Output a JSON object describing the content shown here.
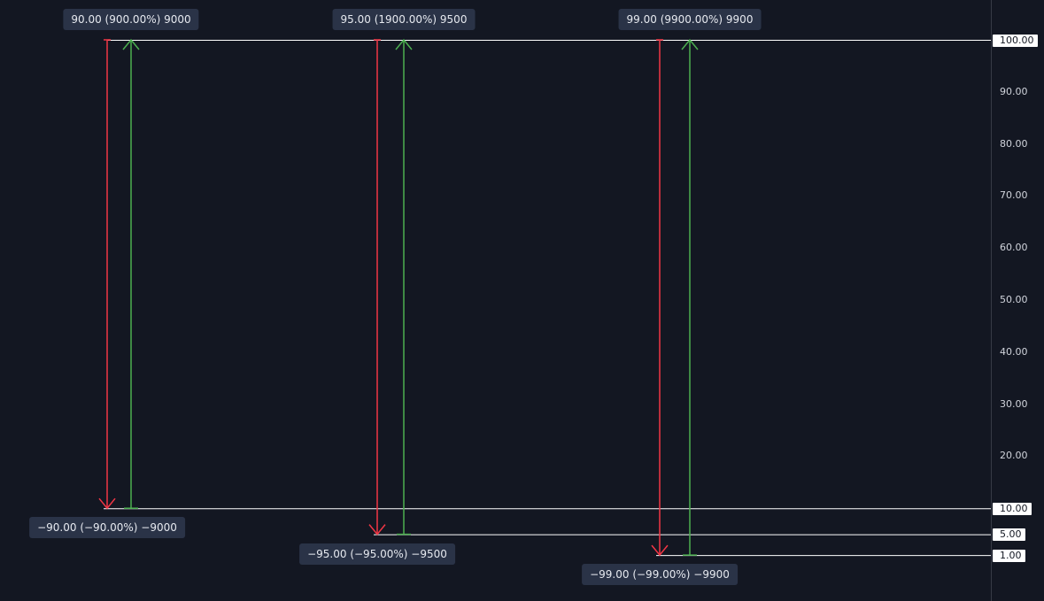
{
  "chart_data": {
    "type": "line",
    "ylim": [
      0,
      100
    ],
    "y_ticks": [
      "90.00",
      "80.00",
      "70.00",
      "60.00",
      "50.00",
      "40.00",
      "30.00",
      "20.00"
    ],
    "price_levels": [
      "100.00",
      "10.00",
      "5.00",
      "1.00"
    ],
    "measurements": [
      {
        "top_label": "90.00 (900.00%) 9000",
        "bottom_label": "−90.00 (−90.00%) −9000",
        "high": 100,
        "low": 10,
        "short_change": "−90.00",
        "long_change": "90.00"
      },
      {
        "top_label": "95.00 (1900.00%) 9500",
        "bottom_label": "−95.00 (−95.00%) −9500",
        "high": 100,
        "low": 5,
        "short_change": "−95.00",
        "long_change": "95.00"
      },
      {
        "top_label": "99.00 (9900.00%) 9900",
        "bottom_label": "−99.00 (−99.00%) −9900",
        "high": 100,
        "low": 1,
        "short_change": "−99.00",
        "long_change": "99.00"
      }
    ],
    "colors": {
      "background": "#131722",
      "down": "#f23645",
      "up": "#4caf50",
      "level_line": "#ffffff",
      "label_bg": "#2a3347",
      "axis_text": "#d1d4dc"
    }
  }
}
